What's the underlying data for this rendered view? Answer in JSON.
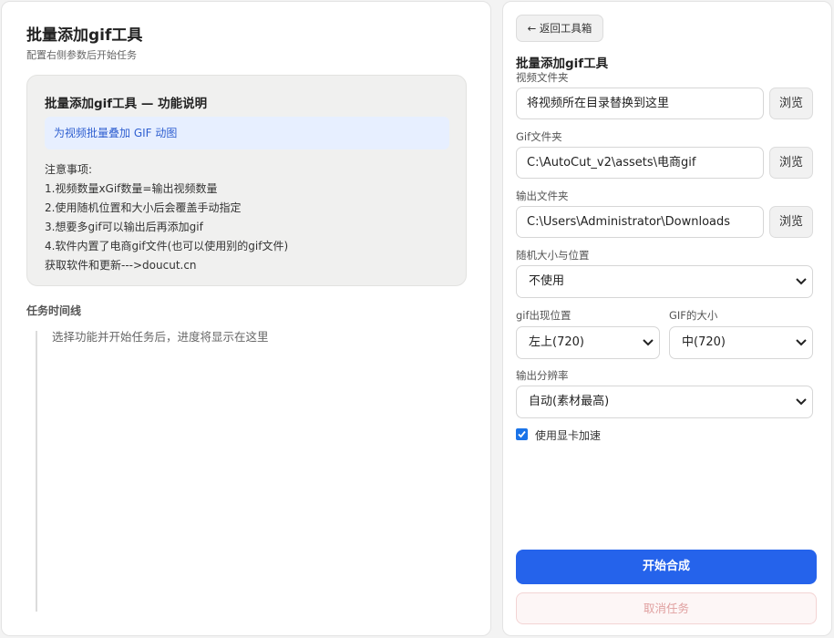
{
  "left": {
    "title": "批量添加gif工具",
    "subtitle": "配置右侧参数后开始任务",
    "info": {
      "title": "批量添加gif工具 — 功能说明",
      "highlight": "为视频批量叠加 GIF 动图",
      "notes": [
        "注意事项:",
        "1.视频数量xGif数量=输出视频数量",
        "2.使用随机位置和大小后会覆盖手动指定",
        "3.想要多gif可以输出后再添加gif",
        "4.软件内置了电商gif文件(也可以使用别的gif文件)",
        "获取软件和更新--->doucut.cn"
      ]
    },
    "timeline": {
      "heading": "任务时间线",
      "empty": "选择功能并开始任务后，进度将显示在这里"
    }
  },
  "right": {
    "back_label": "← 返回工具箱",
    "title": "批量添加gif工具",
    "video_folder": {
      "label": "视频文件夹",
      "value": "将视频所在目录替换到这里",
      "browse": "浏览"
    },
    "gif_folder": {
      "label": "Gif文件夹",
      "value": "C:\\AutoCut_v2\\assets\\电商gif",
      "browse": "浏览"
    },
    "output_folder": {
      "label": "输出文件夹",
      "value": "C:\\Users\\Administrator\\Downloads",
      "browse": "浏览"
    },
    "random": {
      "label": "随机大小与位置",
      "value": "不使用"
    },
    "gif_position": {
      "label": "gif出现位置",
      "value": "左上(720)"
    },
    "gif_size": {
      "label": "GIF的大小",
      "value": "中(720)"
    },
    "resolution": {
      "label": "输出分辨率",
      "value": "自动(素材最高)"
    },
    "gpu": {
      "label": "使用显卡加速",
      "checked": true
    },
    "start_label": "开始合成",
    "cancel_label": "取消任务"
  },
  "colors": {
    "primary": "#2563eb",
    "checkbox": "#1a73e8",
    "highlight_bg": "#e7efff",
    "highlight_text": "#2f5fd0",
    "cancel_text": "#e0a0a0"
  }
}
